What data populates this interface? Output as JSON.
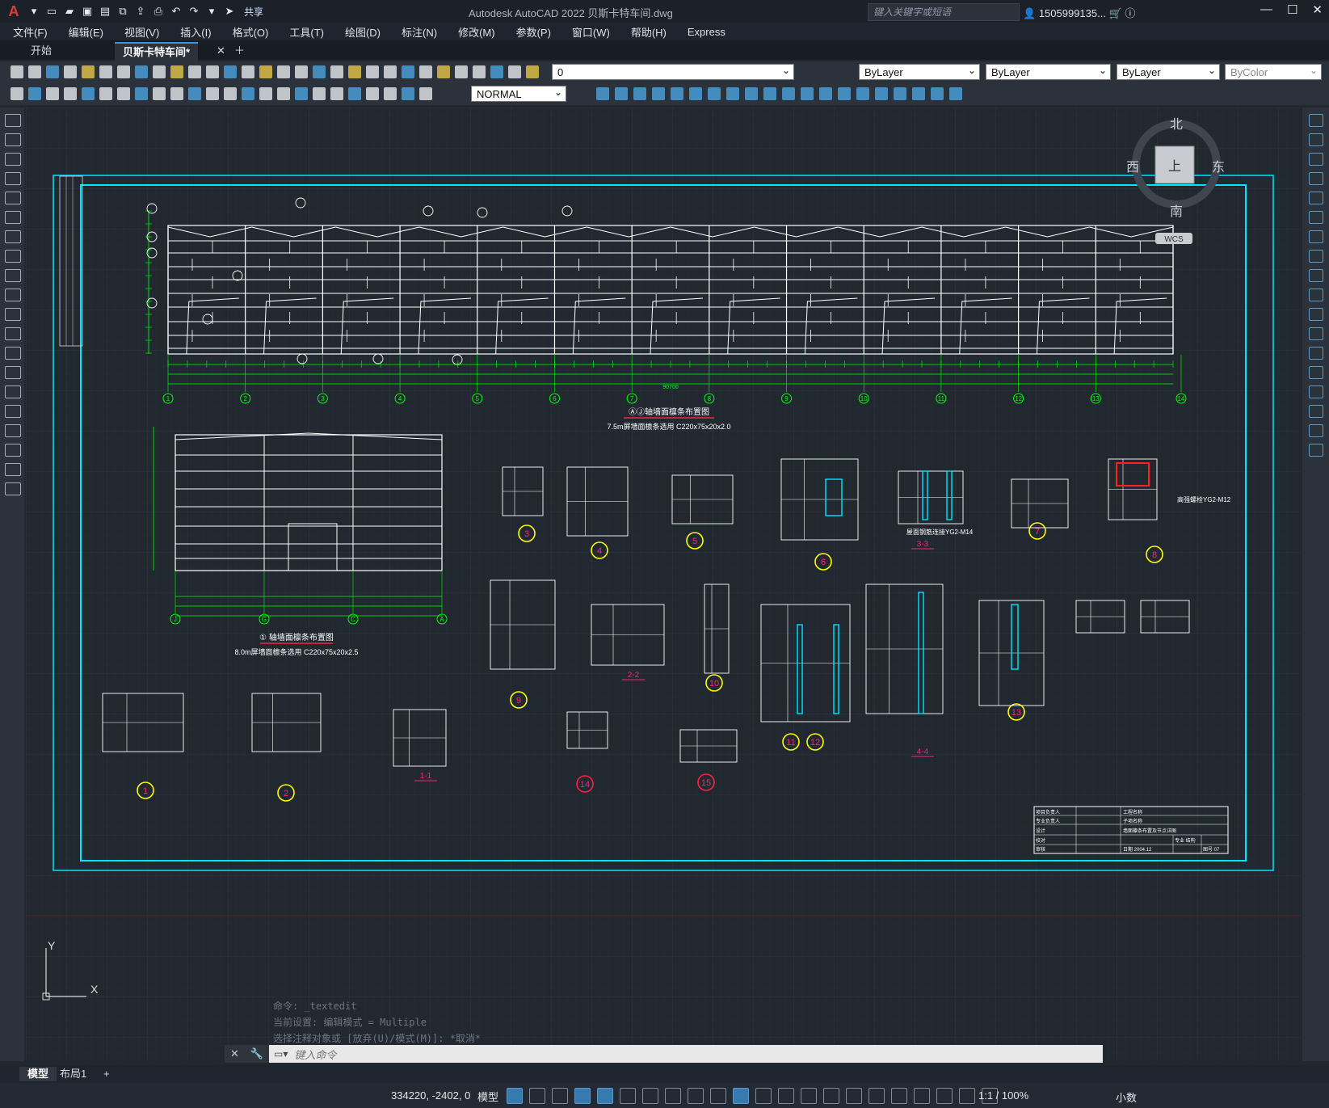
{
  "app": {
    "window_title": "Autodesk AutoCAD 2022    贝斯卡特车间.dwg",
    "share_label": "共享",
    "search_placeholder": "键入关键字或短语",
    "user_label": "1505999135...",
    "logo": "A"
  },
  "menu": [
    "文件(F)",
    "编辑(E)",
    "视图(V)",
    "插入(I)",
    "格式(O)",
    "工具(T)",
    "绘图(D)",
    "标注(N)",
    "修改(M)",
    "参数(P)",
    "窗口(W)",
    "帮助(H)",
    "Express"
  ],
  "file_tabs": [
    {
      "label": "开始",
      "active": false
    },
    {
      "label": "贝斯卡特车间*",
      "active": true
    }
  ],
  "properties": {
    "layer": "0",
    "color": "ByLayer",
    "linetype": "ByLayer",
    "lineweight": "ByLayer",
    "plotstyle": "ByColor",
    "text_style": "NORMAL"
  },
  "viewcube": {
    "north": "北",
    "south": "南",
    "east": "东",
    "west": "西",
    "top": "上",
    "ucs": "WCS"
  },
  "drawing": {
    "title_main": "ⒶⒿ轴墙面檩条布置图",
    "subtitle_main": "7.5m屏墙面檩条选用 C220x75x20x2.0",
    "title_side": "① 轴墙面檩条布置图",
    "subtitle_side": "8.0m屏墙面檩条选用 C220x75x20x2.5",
    "dim_total": "90700",
    "axis_labels": [
      "1",
      "2",
      "3",
      "4",
      "5",
      "6",
      "7",
      "8",
      "9",
      "10",
      "11",
      "12",
      "13",
      "14"
    ],
    "side_axis_labels": [
      "J",
      "G",
      "C",
      "A"
    ],
    "detail_labels": [
      "1",
      "2",
      "3",
      "4",
      "5",
      "6",
      "7",
      "8",
      "9",
      "10",
      "11",
      "12",
      "13",
      "14",
      "15"
    ],
    "section_labels": [
      "1-1",
      "2-2",
      "3-3",
      "4-4"
    ],
    "note_8": "高强螺栓YG2-M12",
    "note_33": "屋面钢筋连接YG2-M14",
    "tb_left": [
      "项目负责人",
      "专业负责人",
      "设计",
      "校对",
      "审核"
    ],
    "tb_right": [
      "工程名称",
      "子项名称",
      "图名",
      "日期 2004.12",
      "专业 结构",
      "图号 07"
    ],
    "tb_title": "墙面檩条布置及节点详图"
  },
  "command": {
    "history": [
      "命令: _textedit",
      "当前设置: 编辑模式 = Multiple",
      "选择注释对象或 [放弃(U)/模式(M)]: *取消*"
    ],
    "placeholder": "键入命令"
  },
  "layout_tabs": [
    {
      "label": "模型",
      "active": true
    },
    {
      "label": "布局1",
      "active": false
    },
    {
      "label": "+",
      "active": false
    }
  ],
  "status": {
    "coords": "334220, -2402, 0",
    "space": "模型",
    "scale": "1:1 / 100%",
    "units": "小数"
  },
  "colors": {
    "background": "#212830",
    "frame": "#00e5ff",
    "dimension": "#00ff00",
    "drawing_lines": "#ffffff",
    "detail_circle": "#ffff00",
    "section_mark": "#ff2080",
    "accent": "#3a95d8"
  }
}
